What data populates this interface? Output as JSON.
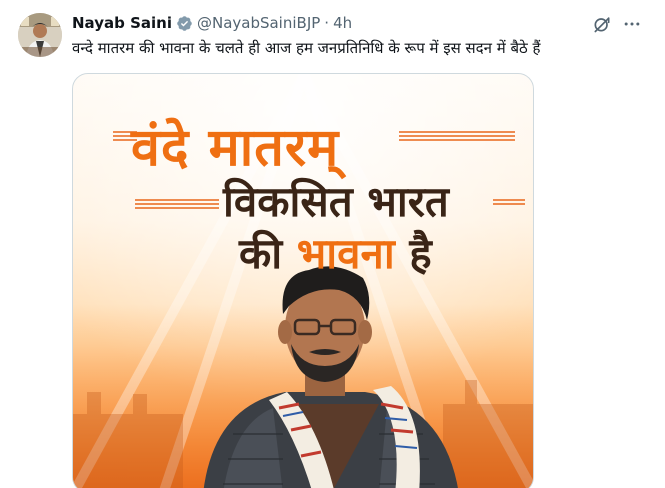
{
  "author": {
    "name": "Nayab Saini",
    "handle": "@NayabSainiBJP",
    "time": "4h",
    "verified_badge_color": "#1d9bf0"
  },
  "tweet": {
    "text": "वन्दे मातरम की भावना के चलते ही आज हम जनप्रतिनिधि के रूप में इस सदन में बैठे हैं"
  },
  "actions": {
    "grok_icon": "grok-icon",
    "more_icon": "more-icon"
  },
  "media": {
    "headline": "वंदे मातरम्",
    "line2": "विकसित भारत",
    "line3_prefix": "की ",
    "line3_accent": "भावना",
    "line3_suffix": " है",
    "colors": {
      "accent": "#ef6f12",
      "dark_text": "#3a2416"
    }
  }
}
